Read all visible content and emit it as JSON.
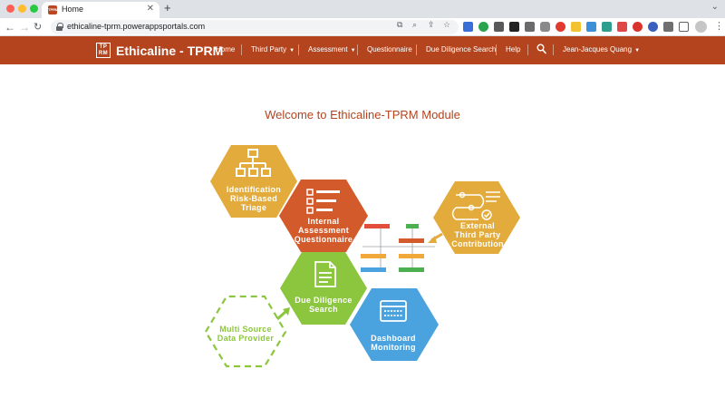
{
  "browser": {
    "tab_title": "Home",
    "tab_favicon_text": "TPRM",
    "url": "ethicaline-tprm.powerappsportals.com"
  },
  "navbar": {
    "brand_logo_text": [
      "TP",
      "RM"
    ],
    "brand": "Ethicaline - TPRM",
    "items": [
      {
        "label": "Home",
        "dropdown": false
      },
      {
        "label": "Third Party",
        "dropdown": true
      },
      {
        "label": "Assessment",
        "dropdown": true
      },
      {
        "label": "Questionnaire",
        "dropdown": false
      },
      {
        "label": "Due Diligence Search",
        "dropdown": false
      },
      {
        "label": "Help",
        "dropdown": false
      }
    ],
    "user": "Jean-Jacques Quang"
  },
  "main": {
    "welcome": "Welcome to Ethicaline-TPRM Module",
    "hexagons": {
      "identification": [
        "Identification",
        "Risk-Based",
        "Triage"
      ],
      "internal_assessment": [
        "Internal",
        "Assessment",
        "Questionnaire"
      ],
      "external": [
        "External",
        "Third Party",
        "Contribution"
      ],
      "due_diligence": [
        "Due Diligence",
        "Search"
      ],
      "dashboard": [
        "Dashboard",
        "Monitoring"
      ],
      "multi_source": [
        "Multi Source",
        "Data Provider"
      ]
    }
  },
  "colors": {
    "brand": "#b3441e",
    "hex_yellow": "#e2ab3b",
    "hex_orange": "#d35a2a",
    "hex_green": "#8cc63f",
    "hex_blue": "#4aa3df"
  }
}
